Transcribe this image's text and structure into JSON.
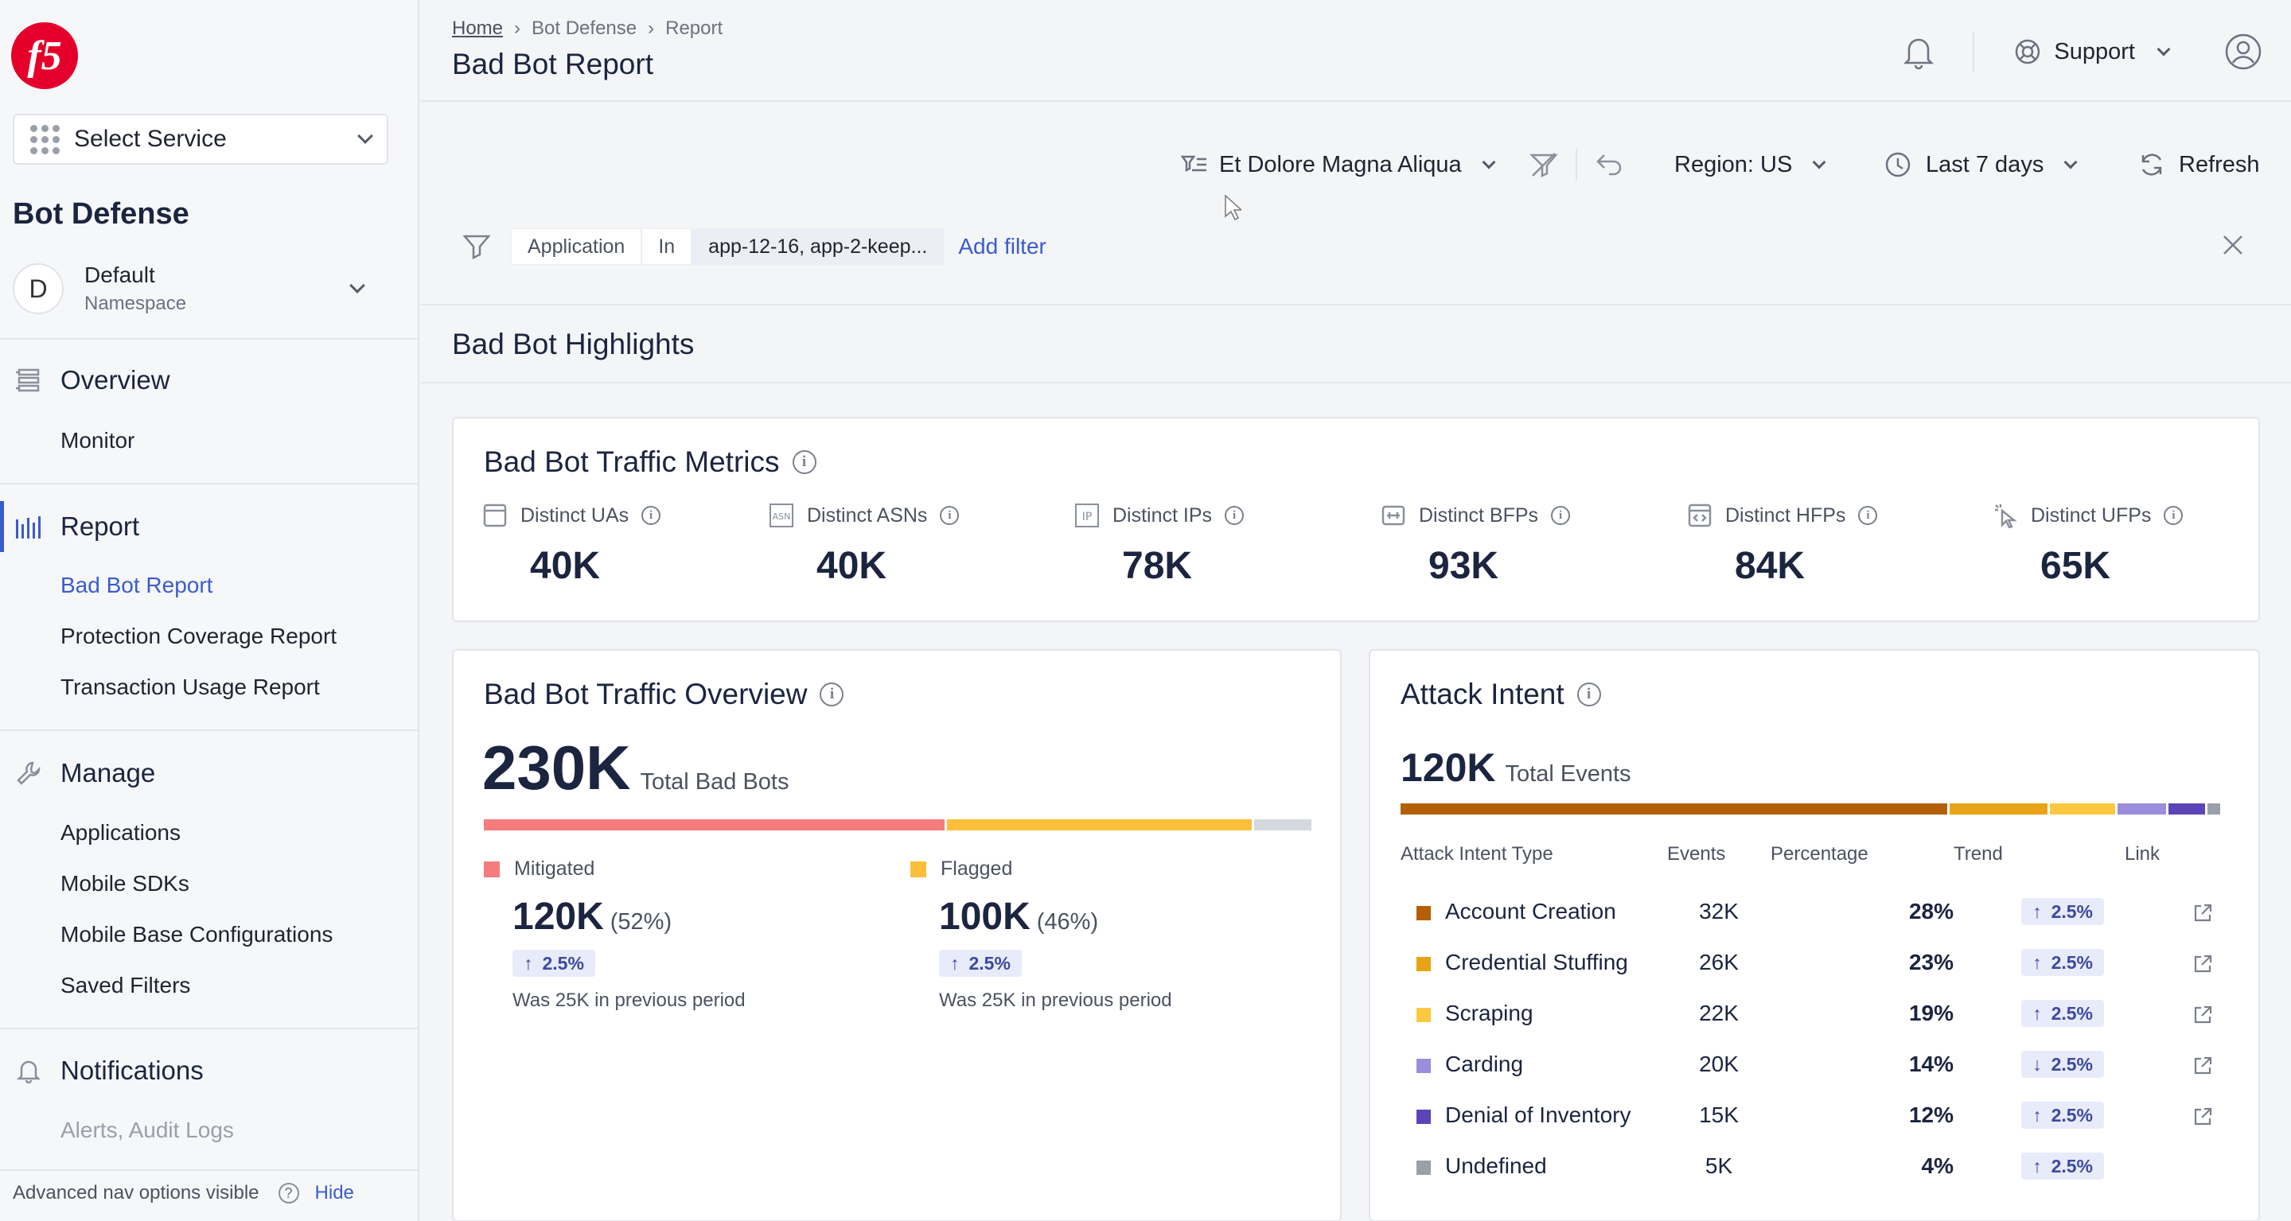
{
  "sidebar": {
    "logo_text": "f5",
    "service_select": "Select Service",
    "product_title": "Bot Defense",
    "namespace": {
      "initial": "D",
      "name": "Default",
      "label": "Namespace"
    },
    "overview": {
      "label": "Overview",
      "items": [
        "Monitor"
      ]
    },
    "report": {
      "label": "Report",
      "items": [
        "Bad Bot Report",
        "Protection Coverage Report",
        "Transaction Usage Report"
      ]
    },
    "manage": {
      "label": "Manage",
      "items": [
        "Applications",
        "Mobile SDKs",
        "Mobile Base Configurations",
        "Saved Filters"
      ]
    },
    "notifications": {
      "label": "Notifications",
      "items": [
        "Alerts, Audit Logs"
      ]
    },
    "footer": {
      "text": "Advanced nav options visible",
      "hide": "Hide"
    }
  },
  "header": {
    "breadcrumbs": [
      "Home",
      "Bot Defense",
      "Report"
    ],
    "title": "Bad Bot Report",
    "support": "Support"
  },
  "toolbar": {
    "saved_filter": "Et Dolore Magna Aliqua",
    "region": "Region: US",
    "time_range": "Last 7 days",
    "refresh": "Refresh"
  },
  "filter": {
    "field": "Application",
    "operator": "In",
    "value": "app-12-16, app-2-keep...",
    "add": "Add filter"
  },
  "section_title": "Bad Bot Highlights",
  "traffic_metrics": {
    "title": "Bad Bot Traffic Metrics",
    "metrics": [
      {
        "label": "Distinct UAs",
        "value": "40K",
        "icon": "browser-window-icon"
      },
      {
        "label": "Distinct ASNs",
        "value": "40K",
        "icon": "asn-icon"
      },
      {
        "label": "Distinct IPs",
        "value": "78K",
        "icon": "ip-icon"
      },
      {
        "label": "Distinct BFPs",
        "value": "93K",
        "icon": "bfp-icon"
      },
      {
        "label": "Distinct HFPs",
        "value": "84K",
        "icon": "code-window-icon"
      },
      {
        "label": "Distinct UFPs",
        "value": "65K",
        "icon": "pointer-click-icon"
      }
    ]
  },
  "traffic_overview": {
    "title": "Bad Bot Traffic Overview",
    "total": "230K",
    "total_label": "Total Bad Bots",
    "bar": [
      {
        "name": "Mitigated",
        "fraction": 0.56,
        "color": "#f47c7c"
      },
      {
        "name": "Flagged",
        "fraction": 0.37,
        "color": "#fbbf3c"
      },
      {
        "name": "Other",
        "fraction": 0.07,
        "color": "#d5d8de"
      }
    ],
    "mitigated": {
      "label": "Mitigated",
      "value": "120K",
      "pct": "(52%)",
      "trend": "2.5%",
      "prev": "Was 25K in previous period"
    },
    "flagged": {
      "label": "Flagged",
      "value": "100K",
      "pct": "(46%)",
      "trend": "2.5%",
      "prev": "Was 25K in previous period"
    }
  },
  "attack_intent": {
    "title": "Attack Intent",
    "total": "120K",
    "total_label": "Total Events",
    "columns": [
      "Attack Intent Type",
      "Events",
      "Percentage",
      "Trend",
      "Link"
    ],
    "rows": [
      {
        "type": "Account Creation",
        "events": "32K",
        "pct": "28%",
        "trend": "2.5%",
        "dir": "up",
        "color": "#b45f06",
        "red": true,
        "link": true,
        "fraction": 0.67
      },
      {
        "type": "Credential Stuffing",
        "events": "26K",
        "pct": "23%",
        "trend": "2.5%",
        "dir": "up",
        "color": "#e8a317",
        "red": true,
        "link": true,
        "fraction": 0.12
      },
      {
        "type": "Scraping",
        "events": "22K",
        "pct": "19%",
        "trend": "2.5%",
        "dir": "up",
        "color": "#fbc840",
        "red": true,
        "link": true,
        "fraction": 0.08
      },
      {
        "type": "Carding",
        "events": "20K",
        "pct": "14%",
        "trend": "2.5%",
        "dir": "down",
        "color": "#9b8ddb",
        "red": false,
        "link": true,
        "fraction": 0.06
      },
      {
        "type": "Denial of Inventory",
        "events": "15K",
        "pct": "12%",
        "trend": "2.5%",
        "dir": "up",
        "color": "#5a44b8",
        "red": false,
        "link": true,
        "fraction": 0.045
      },
      {
        "type": "Undefined",
        "events": "5K",
        "pct": "4%",
        "trend": "2.5%",
        "dir": "up",
        "color": "#9aa0aa",
        "red": false,
        "link": false,
        "fraction": 0.015
      }
    ]
  }
}
